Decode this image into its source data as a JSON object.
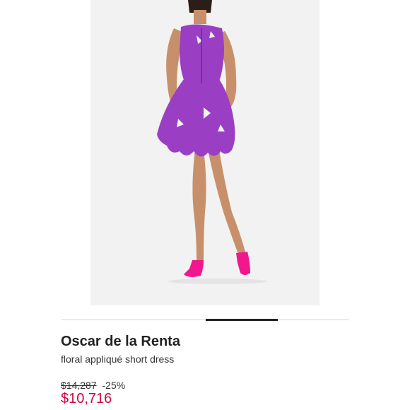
{
  "product": {
    "brand": "Oscar de la Renta",
    "name": "floral appliqué short dress",
    "original_price": "$14,287",
    "discount": "-25%",
    "sale_price": "$10,716"
  },
  "gallery": {
    "image_subject": "back-view-model-purple-dress"
  },
  "colors": {
    "sale_price": "#d1003f",
    "dress": "#9a3fc4",
    "shoes": "#f0178f",
    "background": "#f2f2f2"
  }
}
